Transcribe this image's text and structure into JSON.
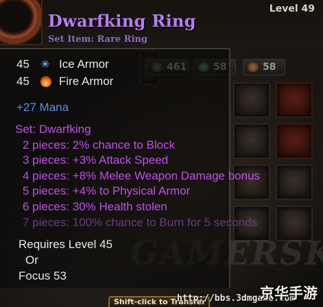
{
  "item": {
    "name": "Dwarfking Ring",
    "subtitle": "Set Item: Rare Ring",
    "level": "Level 49"
  },
  "stats": [
    {
      "value": "45",
      "icon": "snowflake-icon",
      "label": "Ice Armor"
    },
    {
      "value": "45",
      "icon": "flame-icon",
      "label": "Fire Armor"
    }
  ],
  "bonus": "+27 Mana",
  "set": {
    "title": "Set: Dwarfking",
    "pieces": [
      {
        "text": "2 pieces: 2% chance to Block",
        "active": true
      },
      {
        "text": "3 pieces: +3% Attack Speed",
        "active": true
      },
      {
        "text": "4 pieces: +8% Melee Weapon Damage bonus",
        "active": true
      },
      {
        "text": "5 pieces: +4% to Physical Armor",
        "active": true
      },
      {
        "text": "6 pieces: 30% Health stolen",
        "active": true
      },
      {
        "text": "7 pieces: 100% chance to Burn for 5 seconds",
        "active": false
      }
    ]
  },
  "requirements": {
    "line1": "Requires Level 45",
    "line2": "Or",
    "line3": "Focus 53"
  },
  "background": {
    "chips": [
      "461",
      "58",
      "58"
    ],
    "transfer_hint": "Shift-click to Transfer",
    "watermark": "GAMERSKY",
    "url": "http://bbs.3dmgame.com",
    "site_logo": "京华手游"
  },
  "colors": {
    "item_name": "#b77df0",
    "subtitle": "#8f67c9",
    "mana": "#5d8ee0",
    "set_active": "#c14fe8",
    "set_inactive": "#6b3d7c",
    "text": "#e9e9e9"
  }
}
